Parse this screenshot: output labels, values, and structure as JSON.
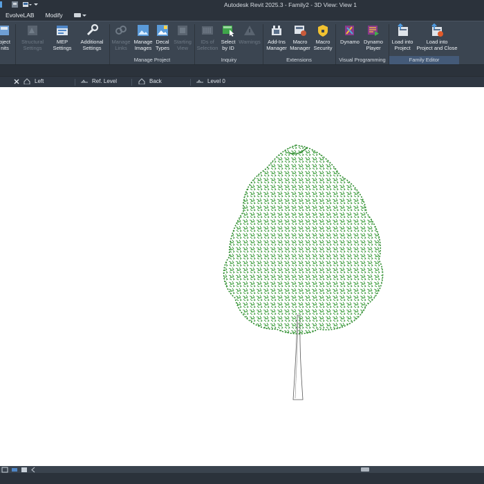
{
  "titlebar": {
    "title": "Autodesk Revit 2025.3 - Family2 - 3D View: View 1"
  },
  "menu": {
    "evolvelab": "EvolveLAB",
    "modify": "Modify"
  },
  "ribbon": {
    "buttons": {
      "project_units": {
        "line1": "oject",
        "line2": "nits"
      },
      "structural_settings": {
        "line1": "Structural",
        "line2": "Settings"
      },
      "mep_settings": {
        "line1": "MEP",
        "line2": "Settings"
      },
      "additional_settings": {
        "line1": "Additional",
        "line2": "Settings"
      },
      "manage_links": {
        "line1": "Manage",
        "line2": "Links"
      },
      "manage_images": {
        "line1": "Manage",
        "line2": "Images"
      },
      "decal_types": {
        "line1": "Decal",
        "line2": "Types"
      },
      "starting_view": {
        "line1": "Starting",
        "line2": "View"
      },
      "ids_of_selection": {
        "line1": "IDs of",
        "line2": "Selection"
      },
      "select_by_id": {
        "line1": "Select",
        "line2": "by ID"
      },
      "warnings": {
        "line1": "Warnings"
      },
      "addins_manager": {
        "line1": "Add-Ins",
        "line2": "Manager"
      },
      "macro_manager": {
        "line1": "Macro",
        "line2": "Manager"
      },
      "macro_security": {
        "line1": "Macro",
        "line2": "Security"
      },
      "dynamo": {
        "line1": "Dynamo"
      },
      "dynamo_player": {
        "line1": "Dynamo",
        "line2": "Player"
      },
      "load_into_project": {
        "line1": "Load into",
        "line2": "Project"
      },
      "load_into_project_close": {
        "line1": "Load into",
        "line2": "Project and Close"
      }
    },
    "panels": {
      "manage_project": "Manage Project",
      "inquiry": "Inquiry",
      "extensions": "Extensions",
      "visual_programming": "Visual Programming",
      "family_editor": "Family Editor"
    }
  },
  "viewbar": {
    "left": "Left",
    "ref_level": "Ref. Level",
    "back": "Back",
    "level0": "Level 0"
  },
  "colors": {
    "ribbon_bg": "#3b4551",
    "titlebar_bg": "#2b323b",
    "foliage": "#2e8b2e",
    "family_editor_panel": "#445a78"
  }
}
